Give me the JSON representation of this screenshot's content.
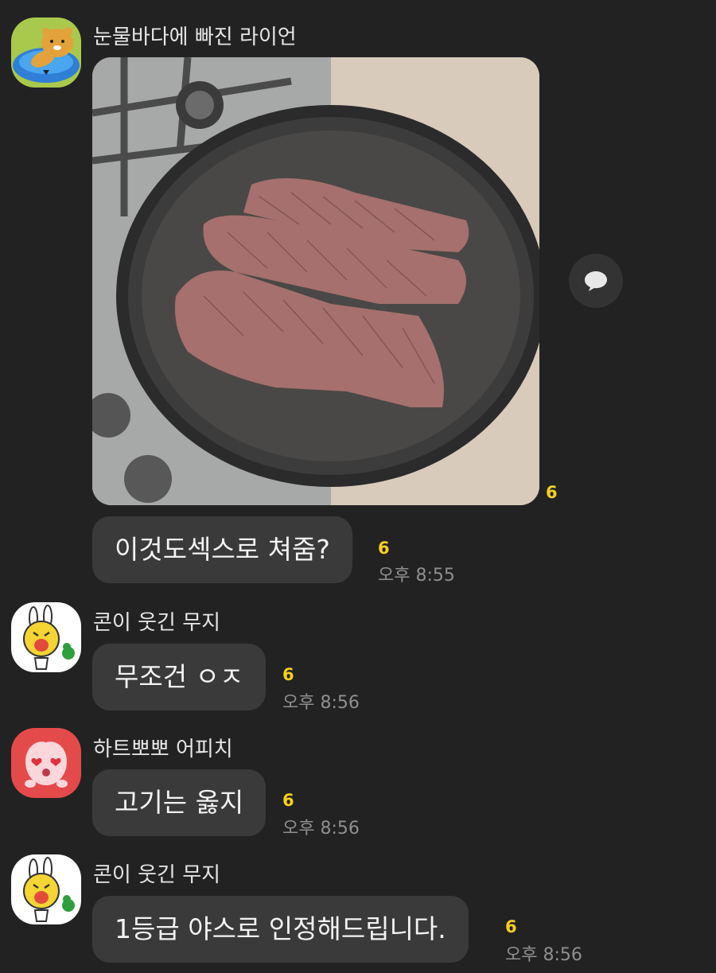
{
  "messages": [
    {
      "sender": "눈물바다에 빠진 라이언",
      "avatar_icon": "ryan-crying-avatar-icon",
      "photo_description_icon": "steak-in-pan-photo",
      "photo_unread": "6",
      "text": "이것도섹스로 쳐줌?",
      "unread": "6",
      "time": "오후 8:55"
    },
    {
      "sender": "콘이 웃긴 무지",
      "avatar_icon": "muzi-laughing-avatar-icon",
      "text": "무조건 ㅇㅈ",
      "unread": "6",
      "time": "오후 8:56"
    },
    {
      "sender": "하트뽀뽀 어피치",
      "avatar_icon": "apeach-heart-avatar-icon",
      "text": "고기는 옳지",
      "unread": "6",
      "time": "오후 8:56"
    },
    {
      "sender": "콘이 웃긴 무지",
      "avatar_icon": "muzi-laughing-avatar-icon",
      "text": "1등급 야스로 인정해드립니다.",
      "unread": "6",
      "time": "오후 8:56"
    }
  ],
  "colors": {
    "background": "#222223",
    "bubble": "#3a3a3b",
    "unread": "#f5d11b",
    "time": "#8f8f8f"
  },
  "share_icon": "speech-bubble-icon"
}
